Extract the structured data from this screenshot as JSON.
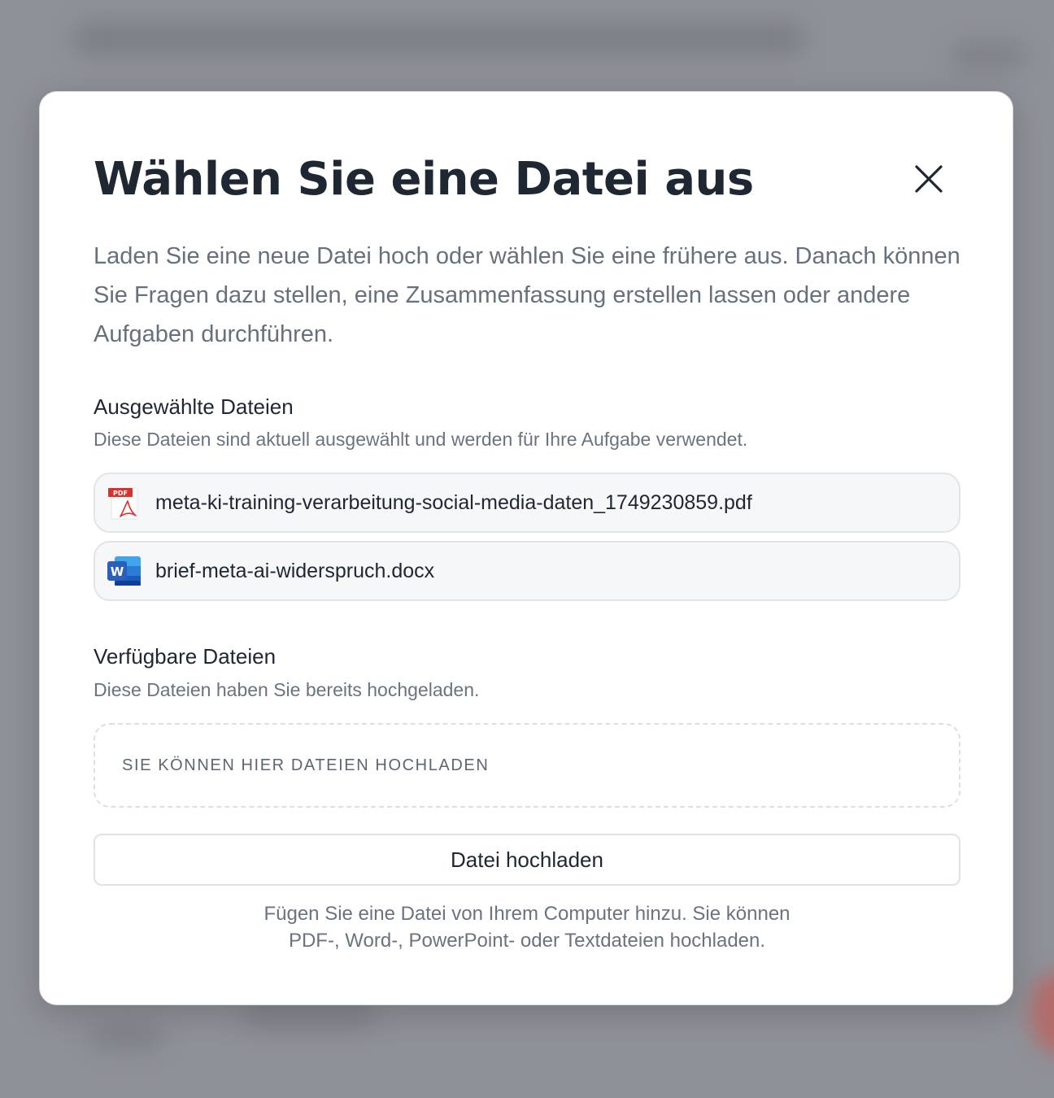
{
  "dialog": {
    "title": "Wählen Sie eine Datei aus",
    "intro": "Laden Sie eine neue Datei hoch oder wählen Sie eine frühere aus. Danach können Sie Fragen dazu stellen, eine Zusammenfassung erstellen lassen oder andere Aufgaben durchführen.",
    "close_icon": "close-icon"
  },
  "selected": {
    "title": "Ausgewählte Dateien",
    "subtitle": "Diese Dateien sind aktuell ausgewählt und werden für Ihre Aufgabe verwendet.",
    "files": [
      {
        "name": "meta-ki-training-verarbeitung-social-media-daten_1749230859.pdf",
        "icon": "pdf-icon",
        "icon_label": "PDF"
      },
      {
        "name": "brief-meta-ai-widerspruch.docx",
        "icon": "word-icon",
        "icon_label": "W"
      }
    ]
  },
  "available": {
    "title": "Verfügbare Dateien",
    "subtitle": "Diese Dateien haben Sie bereits hochgeladen.",
    "dropzone_label": "SIE KÖNNEN HIER DATEIEN HOCHLADEN"
  },
  "upload": {
    "button_label": "Datei hochladen",
    "hint_line1": "Fügen Sie eine Datei von Ihrem Computer hinzu. Sie können",
    "hint_line2": "PDF-, Word-, PowerPoint- oder Textdateien hochladen."
  },
  "colors": {
    "overlay": "#8e9197",
    "title_text": "#1f2733",
    "muted_text": "#67707d",
    "pdf_red": "#d9312b",
    "word_blue": "#2b5fb9"
  }
}
